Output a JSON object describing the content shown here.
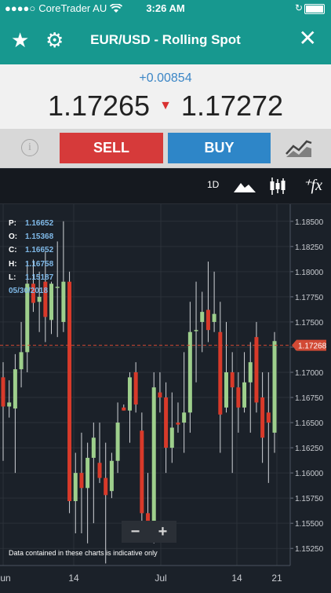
{
  "status": {
    "carrier": "CoreTrader AU",
    "time": "3:26 AM"
  },
  "nav": {
    "title": "EUR/USD - Rolling Spot"
  },
  "quote": {
    "change": "+0.00854",
    "bid": "1.17265",
    "ask": "1.17272"
  },
  "actions": {
    "sell_label": "SELL",
    "buy_label": "BUY"
  },
  "chart_toolbar": {
    "period": "1D"
  },
  "ohlc": {
    "p_label": "P:",
    "p": "1.16652",
    "o_label": "O:",
    "o": "1.15368",
    "c_label": "C:",
    "c": "1.16652",
    "h_label": "H:",
    "h": "1.16758",
    "l_label": "L:",
    "l": "1.15187",
    "date": "05/30/2018"
  },
  "zoom": {
    "out": "−",
    "in": "+"
  },
  "disclaimer": "Data contained in these charts is indicative only",
  "chart_data": {
    "type": "candlestick",
    "y_ticks": [
      "1.18500",
      "1.18250",
      "1.18000",
      "1.17750",
      "1.17500",
      "1.17250",
      "1.17000",
      "1.16750",
      "1.16500",
      "1.16250",
      "1.16000",
      "1.15750",
      "1.15500",
      "1.15250"
    ],
    "x_ticks": [
      "Jun",
      "14",
      "Jul",
      "14",
      "21"
    ],
    "ylim": [
      1.1508,
      1.1867
    ],
    "current_price": "1.17268",
    "colors": {
      "up": "#9ecf8c",
      "down": "#d83a2a",
      "current_line": "#d24a35"
    },
    "candles": [
      {
        "o": 1.1695,
        "h": 1.171,
        "l": 1.1612,
        "c": 1.1666
      },
      {
        "o": 1.1666,
        "h": 1.1692,
        "l": 1.1655,
        "c": 1.167
      },
      {
        "o": 1.1664,
        "h": 1.1718,
        "l": 1.16,
        "c": 1.1703
      },
      {
        "o": 1.1703,
        "h": 1.175,
        "l": 1.1685,
        "c": 1.172
      },
      {
        "o": 1.172,
        "h": 1.181,
        "l": 1.17,
        "c": 1.1788
      },
      {
        "o": 1.1788,
        "h": 1.1812,
        "l": 1.176,
        "c": 1.1769
      },
      {
        "o": 1.177,
        "h": 1.18,
        "l": 1.174,
        "c": 1.1775
      },
      {
        "o": 1.179,
        "h": 1.182,
        "l": 1.173,
        "c": 1.1755
      },
      {
        "o": 1.1752,
        "h": 1.179,
        "l": 1.1738,
        "c": 1.1788
      },
      {
        "o": 1.1785,
        "h": 1.183,
        "l": 1.1735,
        "c": 1.1785
      },
      {
        "o": 1.175,
        "h": 1.185,
        "l": 1.174,
        "c": 1.179
      },
      {
        "o": 1.179,
        "h": 1.18,
        "l": 1.156,
        "c": 1.1572
      },
      {
        "o": 1.1572,
        "h": 1.162,
        "l": 1.154,
        "c": 1.16
      },
      {
        "o": 1.16,
        "h": 1.164,
        "l": 1.154,
        "c": 1.1585
      },
      {
        "o": 1.1585,
        "h": 1.163,
        "l": 1.153,
        "c": 1.1615
      },
      {
        "o": 1.1615,
        "h": 1.165,
        "l": 1.155,
        "c": 1.1635
      },
      {
        "o": 1.161,
        "h": 1.165,
        "l": 1.159,
        "c": 1.1595
      },
      {
        "o": 1.1595,
        "h": 1.163,
        "l": 1.151,
        "c": 1.1578
      },
      {
        "o": 1.1582,
        "h": 1.162,
        "l": 1.1575,
        "c": 1.1612
      },
      {
        "o": 1.1612,
        "h": 1.167,
        "l": 1.16,
        "c": 1.165
      },
      {
        "o": 1.1665,
        "h": 1.1668,
        "l": 1.1662,
        "c": 1.1662
      },
      {
        "o": 1.1662,
        "h": 1.17,
        "l": 1.163,
        "c": 1.1695
      },
      {
        "o": 1.17,
        "h": 1.171,
        "l": 1.166,
        "c": 1.1668
      },
      {
        "o": 1.1642,
        "h": 1.166,
        "l": 1.154,
        "c": 1.156
      },
      {
        "o": 1.156,
        "h": 1.16,
        "l": 1.154,
        "c": 1.155
      },
      {
        "o": 1.155,
        "h": 1.17,
        "l": 1.153,
        "c": 1.1685
      },
      {
        "o": 1.168,
        "h": 1.17,
        "l": 1.166,
        "c": 1.1675
      },
      {
        "o": 1.1675,
        "h": 1.169,
        "l": 1.16,
        "c": 1.1625
      },
      {
        "o": 1.1625,
        "h": 1.168,
        "l": 1.161,
        "c": 1.1645
      },
      {
        "o": 1.165,
        "h": 1.167,
        "l": 1.164,
        "c": 1.1648
      },
      {
        "o": 1.165,
        "h": 1.172,
        "l": 1.162,
        "c": 1.166
      },
      {
        "o": 1.166,
        "h": 1.177,
        "l": 1.164,
        "c": 1.174
      },
      {
        "o": 1.1742,
        "h": 1.179,
        "l": 1.169,
        "c": 1.1742
      },
      {
        "o": 1.175,
        "h": 1.178,
        "l": 1.172,
        "c": 1.176
      },
      {
        "o": 1.1762,
        "h": 1.181,
        "l": 1.173,
        "c": 1.1742
      },
      {
        "o": 1.175,
        "h": 1.18,
        "l": 1.174,
        "c": 1.1758
      },
      {
        "o": 1.174,
        "h": 1.177,
        "l": 1.162,
        "c": 1.1658
      },
      {
        "o": 1.1665,
        "h": 1.175,
        "l": 1.166,
        "c": 1.17
      },
      {
        "o": 1.17,
        "h": 1.172,
        "l": 1.16,
        "c": 1.1685
      },
      {
        "o": 1.1685,
        "h": 1.17,
        "l": 1.164,
        "c": 1.1665
      },
      {
        "o": 1.1665,
        "h": 1.172,
        "l": 1.166,
        "c": 1.169
      },
      {
        "o": 1.169,
        "h": 1.173,
        "l": 1.164,
        "c": 1.171
      },
      {
        "o": 1.1735,
        "h": 1.175,
        "l": 1.166,
        "c": 1.167
      },
      {
        "o": 1.1675,
        "h": 1.17,
        "l": 1.161,
        "c": 1.1635
      },
      {
        "o": 1.166,
        "h": 1.17,
        "l": 1.159,
        "c": 1.165
      },
      {
        "o": 1.164,
        "h": 1.174,
        "l": 1.162,
        "c": 1.1731
      }
    ]
  }
}
